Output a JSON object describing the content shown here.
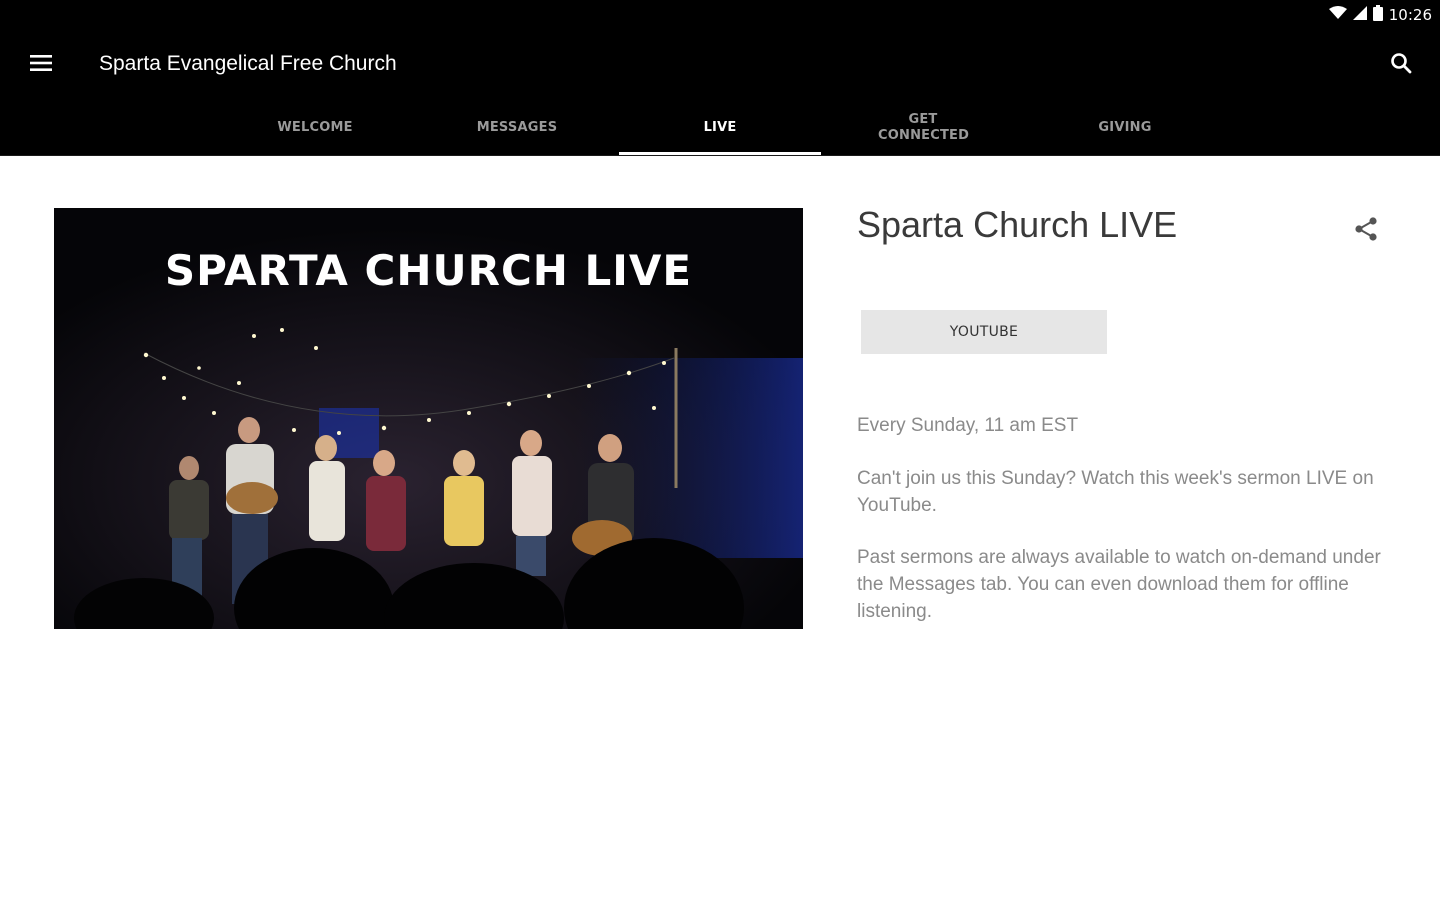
{
  "status_bar": {
    "time": "10:26",
    "icons": [
      "wifi-icon",
      "signal-icon",
      "battery-icon"
    ]
  },
  "app_bar": {
    "title": "Sparta Evangelical Free Church",
    "menu_icon": "menu-icon",
    "search_icon": "search-icon"
  },
  "tabs": [
    {
      "label": "WELCOME",
      "active": false
    },
    {
      "label": "MESSAGES",
      "active": false
    },
    {
      "label": "LIVE",
      "active": true
    },
    {
      "label": "GET CONNECTED",
      "active": false
    },
    {
      "label": "GIVING",
      "active": false
    }
  ],
  "content": {
    "hero_image_text": "SPARTA CHURCH LIVE",
    "title": "Sparta Church LIVE",
    "share_icon": "share-icon",
    "button_label": "YOUTUBE",
    "paragraphs": [
      "Every Sunday, 11 am EST",
      "Can't join us this Sunday? Watch this week's sermon LIVE on YouTube.",
      "Past sermons are always available to watch on-demand under the Messages tab. You can even download them for offline listening."
    ]
  },
  "colors": {
    "bar": "#000000",
    "active_tab": "#ffffff",
    "inactive_tab": "#9a9a9a",
    "button_bg": "#e6e6e6",
    "text_muted": "#8a8a8a"
  }
}
